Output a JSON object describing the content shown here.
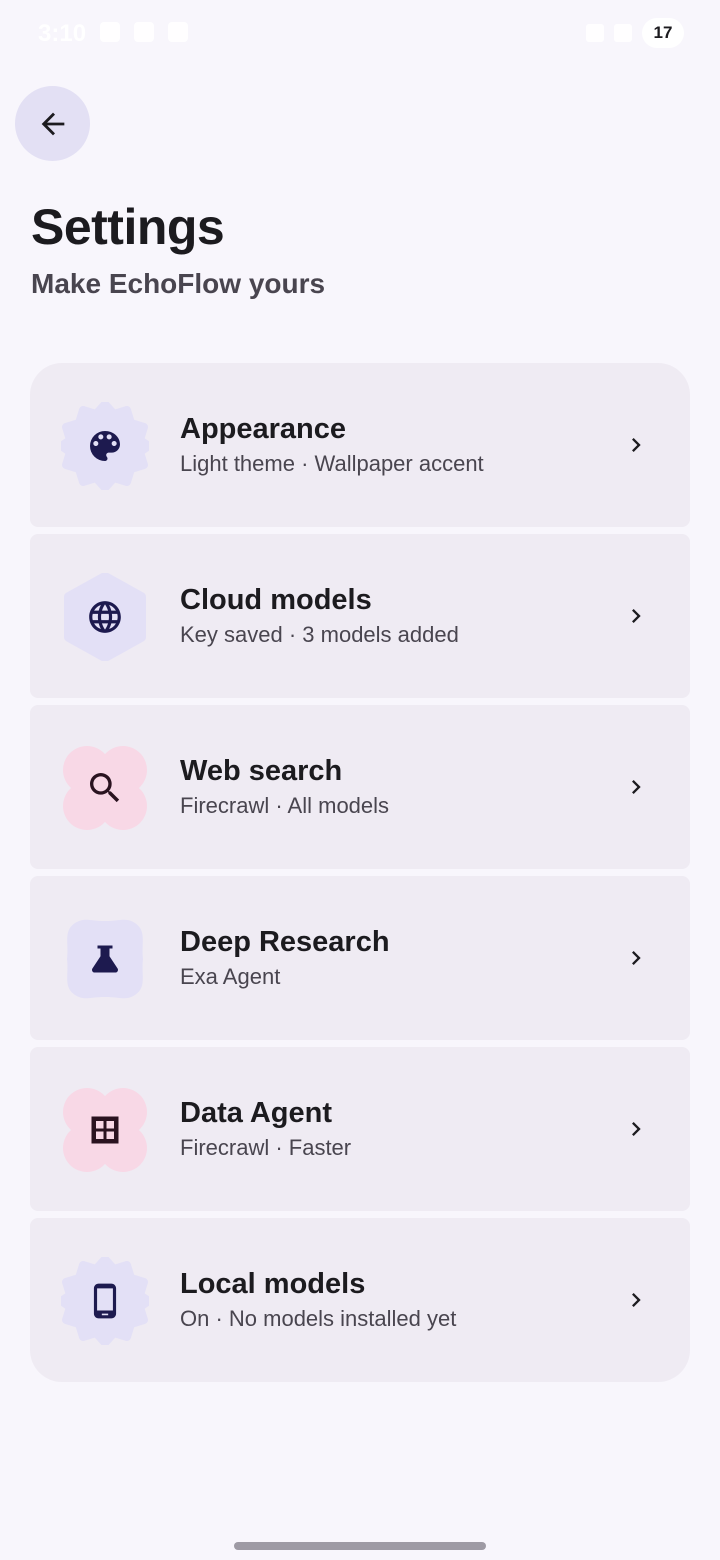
{
  "status_bar": {
    "time": "3:10",
    "battery": "17"
  },
  "header": {
    "back_label": "Back",
    "title": "Settings",
    "subtitle": "Make EchoFlow yours"
  },
  "settings": [
    {
      "title": "Appearance",
      "subtitle": "Light theme · Wallpaper accent",
      "icon": "palette-icon",
      "shape_color": "#e3e0f6",
      "glyph_color": "#1d1a4f"
    },
    {
      "title": "Cloud models",
      "subtitle": "Key saved · 3 models added",
      "icon": "globe-icon",
      "shape_color": "#e3e0f6",
      "glyph_color": "#1d1a4f"
    },
    {
      "title": "Web search",
      "subtitle": "Firecrawl · All models",
      "icon": "search-icon",
      "shape_color": "#f8d8e6",
      "glyph_color": "#2a1320"
    },
    {
      "title": "Deep Research",
      "subtitle": "Exa Agent",
      "icon": "flask-icon",
      "shape_color": "#e3e0f6",
      "glyph_color": "#1d1a4f"
    },
    {
      "title": "Data Agent",
      "subtitle": "Firecrawl · Faster",
      "icon": "grid-icon",
      "shape_color": "#f8d8e6",
      "glyph_color": "#2a1320"
    },
    {
      "title": "Local models",
      "subtitle": "On · No models installed yet",
      "icon": "phone-icon",
      "shape_color": "#e3e0f6",
      "glyph_color": "#1d1a4f"
    }
  ]
}
